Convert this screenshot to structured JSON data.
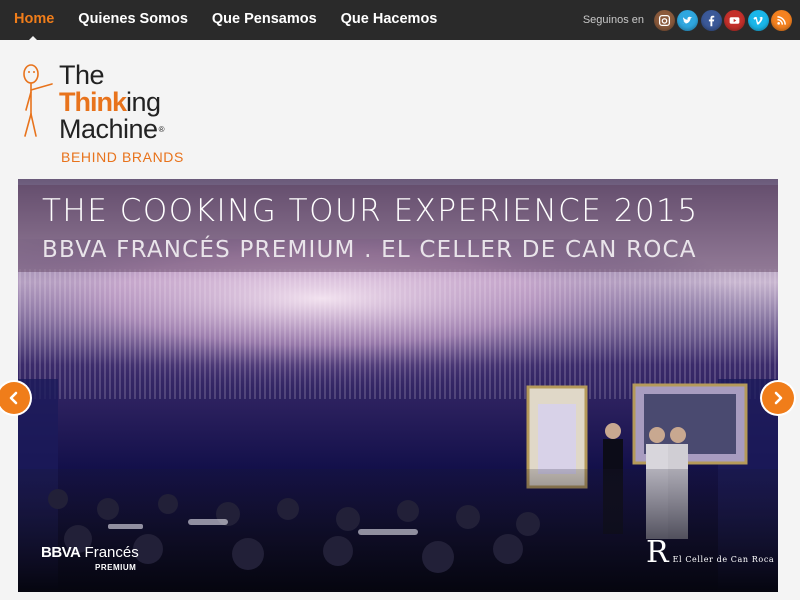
{
  "nav": {
    "items": [
      {
        "label": "Home",
        "active": true
      },
      {
        "label": "Quienes Somos",
        "active": false
      },
      {
        "label": "Que Pensamos",
        "active": false
      },
      {
        "label": "Que Hacemos",
        "active": false
      }
    ]
  },
  "social": {
    "label": "Seguinos en",
    "icons": [
      {
        "name": "instagram-icon",
        "color": "#8a5a3c"
      },
      {
        "name": "twitter-icon",
        "color": "#2fa7df"
      },
      {
        "name": "facebook-icon",
        "color": "#3b5998"
      },
      {
        "name": "youtube-icon",
        "color": "#c4302b"
      },
      {
        "name": "vimeo-icon",
        "color": "#1ab7ea"
      },
      {
        "name": "rss-icon",
        "color": "#f58220"
      }
    ]
  },
  "logo": {
    "line1": "The",
    "line2_bold": "Think",
    "line2_rest": "ing",
    "line3": "Machine",
    "registered": "®",
    "tagline": "BEHIND BRANDS"
  },
  "slide": {
    "title": "THE COOKING TOUR EXPERIENCE 2015",
    "subtitle": "BBVA FRANCÉS PREMIUM . EL CELLER DE CAN ROCA",
    "sponsor_bold": "BBVA",
    "sponsor_rest": " Francés",
    "sponsor_sub": "PREMIUM",
    "partner_mark": "R",
    "partner_name": "El Celler de Can Roca"
  },
  "colors": {
    "accent": "#f07d1a",
    "nav_bg": "#2a2a2a",
    "logo_orange": "#e8731c"
  }
}
